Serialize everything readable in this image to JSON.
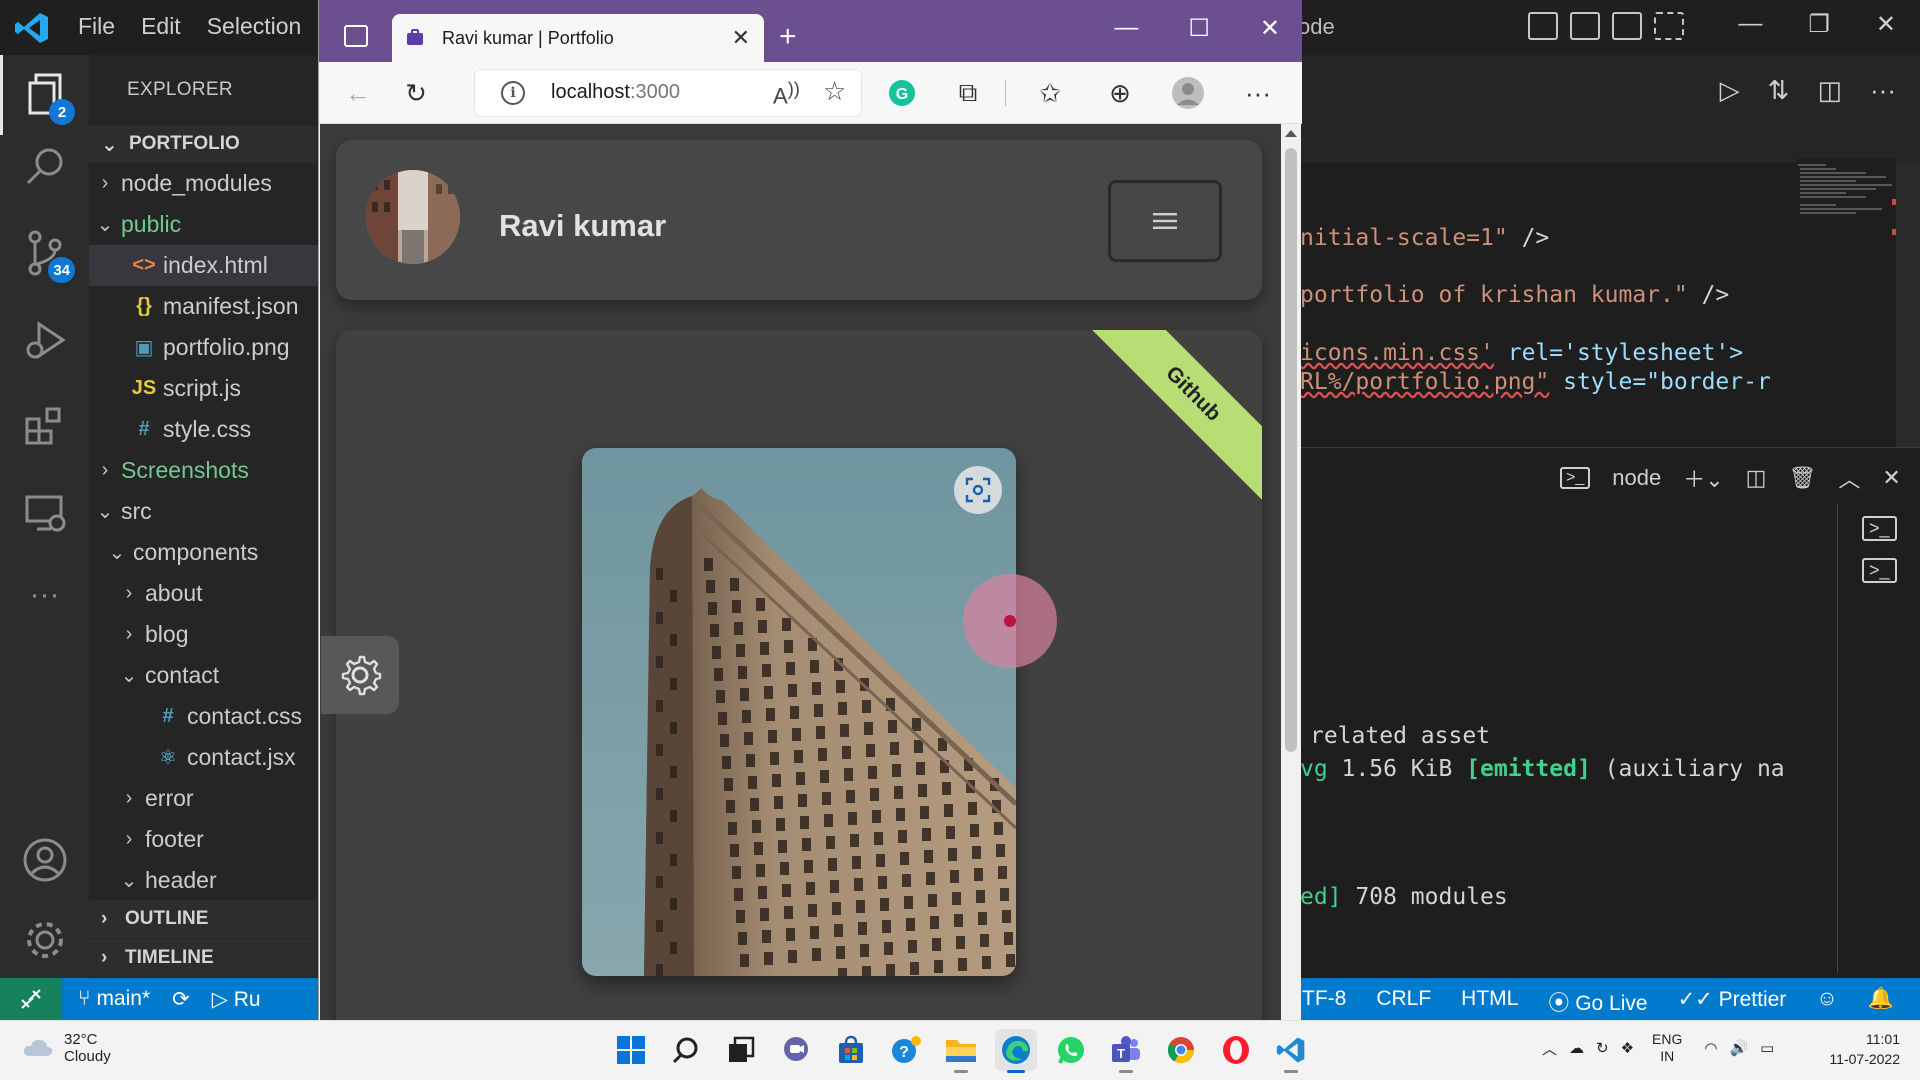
{
  "vscode": {
    "menu": [
      "File",
      "Edit",
      "Selection"
    ],
    "title_fragment": "ode",
    "activity": {
      "explorer_badge": "2",
      "scm_badge": "34"
    },
    "explorer_title": "EXPLORER",
    "project": "PORTFOLIO",
    "tree": [
      {
        "label": "node_modules",
        "indent": 1,
        "chev": "›",
        "icon": "",
        "cls": ""
      },
      {
        "label": "public",
        "indent": 1,
        "chev": "⌄",
        "icon": "",
        "cls": "green"
      },
      {
        "label": "index.html",
        "indent": 2,
        "chev": "",
        "icon": "<>",
        "cls": "orange",
        "selected": true
      },
      {
        "label": "manifest.json",
        "indent": 2,
        "chev": "",
        "icon": "{}",
        "cls": "yellow"
      },
      {
        "label": "portfolio.png",
        "indent": 2,
        "chev": "",
        "icon": "▣",
        "cls": "blue"
      },
      {
        "label": "script.js",
        "indent": 2,
        "chev": "",
        "icon": "JS",
        "cls": "yellow"
      },
      {
        "label": "style.css",
        "indent": 2,
        "chev": "",
        "icon": "#",
        "cls": "blue"
      },
      {
        "label": "Screenshots",
        "indent": 1,
        "chev": "›",
        "icon": "",
        "cls": "green"
      },
      {
        "label": "src",
        "indent": 1,
        "chev": "⌄",
        "icon": "",
        "cls": ""
      },
      {
        "label": "components",
        "indent": 2,
        "chev": "⌄",
        "icon": "",
        "cls": ""
      },
      {
        "label": "about",
        "indent": 3,
        "chev": "›",
        "icon": "",
        "cls": ""
      },
      {
        "label": "blog",
        "indent": 3,
        "chev": "›",
        "icon": "",
        "cls": ""
      },
      {
        "label": "contact",
        "indent": 3,
        "chev": "⌄",
        "icon": "",
        "cls": ""
      },
      {
        "label": "contact.css",
        "indent": 4,
        "chev": "",
        "icon": "#",
        "cls": "blue"
      },
      {
        "label": "contact.jsx",
        "indent": 4,
        "chev": "",
        "icon": "⚛",
        "cls": "cyan"
      },
      {
        "label": "error",
        "indent": 3,
        "chev": "›",
        "icon": "",
        "cls": ""
      },
      {
        "label": "footer",
        "indent": 3,
        "chev": "›",
        "icon": "",
        "cls": ""
      },
      {
        "label": "header",
        "indent": 3,
        "chev": "⌄",
        "icon": "",
        "cls": ""
      }
    ],
    "outline": "OUTLINE",
    "timeline": "TIMELINE",
    "code_lines": [
      {
        "a": "nitial-scale=1\"",
        "b": " />"
      },
      {
        "a": "portfolio of krishan kumar.\"",
        "b": " />"
      },
      {
        "a": "icons.min.css'",
        "b": " rel='stylesheet'>"
      },
      {
        "a": "RL%/portfolio.png\"",
        "b": " style=\"border-r"
      }
    ],
    "terminal": {
      "label": "node",
      "lines": [
        "related asset",
        "vg 1.56 KiB [emitted] (auxiliary na",
        "ed] 708 modules"
      ],
      "emitted": "[emitted]"
    },
    "status": {
      "branch": "main*",
      "run": "Ru",
      "encoding": "TF-8",
      "eol": "CRLF",
      "language": "HTML",
      "golive": "Go Live",
      "prettier": "Prettier"
    }
  },
  "browser": {
    "tab_title": "Ravi kumar | Portfolio",
    "url_host": "localhost",
    "url_port": ":3000",
    "site": {
      "name": "Ravi kumar",
      "ribbon": "Github"
    }
  },
  "taskbar": {
    "weather_temp": "32°C",
    "weather_desc": "Cloudy",
    "lang_top": "ENG",
    "lang_bottom": "IN",
    "time": "11:01",
    "date": "11-07-2022"
  },
  "colors": {
    "vscode_status": "#007acc",
    "browser_tabstrip": "#6b4f8f",
    "ribbon": "#b6de75",
    "cursor_dot": "#c0123f"
  }
}
